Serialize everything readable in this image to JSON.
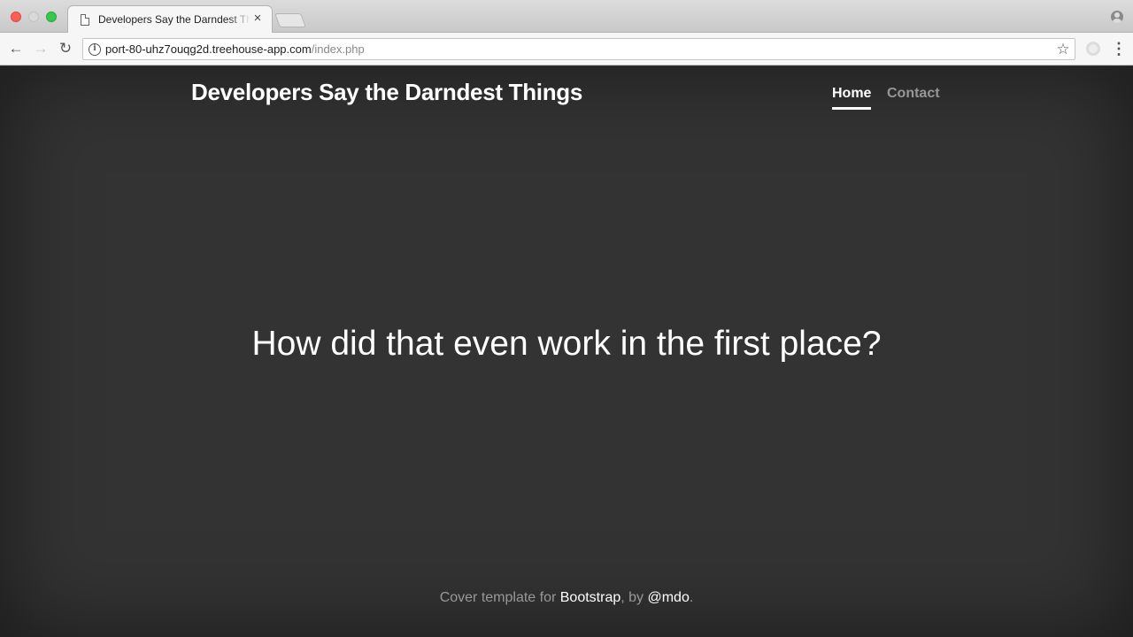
{
  "browser": {
    "tab": {
      "title": "Developers Say the Darndest Things",
      "close_glyph": "×"
    },
    "address_bar": {
      "host": "port-80-uhz7ouqg2d.treehouse-app.com",
      "path": "/index.php"
    },
    "icons": {
      "back": "arrow-left-icon",
      "forward": "arrow-right-icon",
      "reload": "reload-icon",
      "info": "info-icon",
      "bookmark": "star-icon",
      "extension": "extension-icon",
      "menu": "kebab-menu-icon",
      "profile": "profile-icon"
    }
  },
  "site": {
    "brand": "Developers Say the Darndest Things",
    "nav": [
      {
        "label": "Home",
        "active": true
      },
      {
        "label": "Contact",
        "active": false
      }
    ]
  },
  "main": {
    "quote": "How did that even work in the first place?"
  },
  "footer": {
    "prefix": "Cover template for ",
    "link1": "Bootstrap",
    "middle": ", by ",
    "link2": "@mdo",
    "suffix": "."
  },
  "colors": {
    "background": "#333333",
    "text": "#ffffff",
    "muted_text": "rgba(255,255,255,0.5)"
  }
}
